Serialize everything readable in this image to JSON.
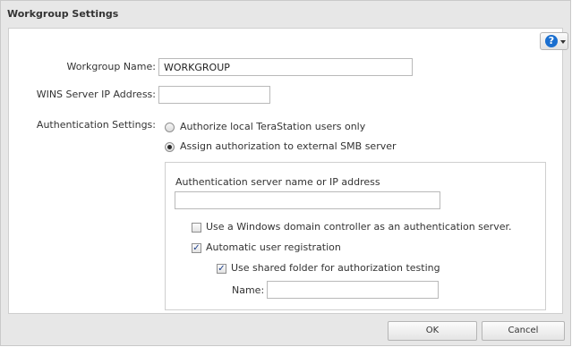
{
  "dialog": {
    "title": "Workgroup Settings"
  },
  "help": {
    "glyph": "?"
  },
  "fields": {
    "workgroup_name_label": "Workgroup Name:",
    "workgroup_name_value": "WORKGROUP",
    "wins_label": "WINS Server IP Address:",
    "wins_value": "",
    "auth_label": "Authentication Settings:"
  },
  "auth_options": [
    {
      "label": "Authorize local TeraStation users only",
      "selected": false
    },
    {
      "label": "Assign authorization to external SMB server",
      "selected": true
    }
  ],
  "external": {
    "server_label": "Authentication server name or IP address",
    "server_value": "",
    "domain_controller_label": "Use a Windows domain controller as an authentication server.",
    "domain_controller_checked": false,
    "auto_register_label": "Automatic user registration",
    "auto_register_checked": true,
    "shared_folder_label": "Use shared folder for authorization testing",
    "shared_folder_checked": true,
    "name_label": "Name:",
    "name_value": ""
  },
  "buttons": {
    "ok": "OK",
    "cancel": "Cancel"
  },
  "icons": {
    "help": "help-icon",
    "dropdown": "chevron-down-icon"
  }
}
